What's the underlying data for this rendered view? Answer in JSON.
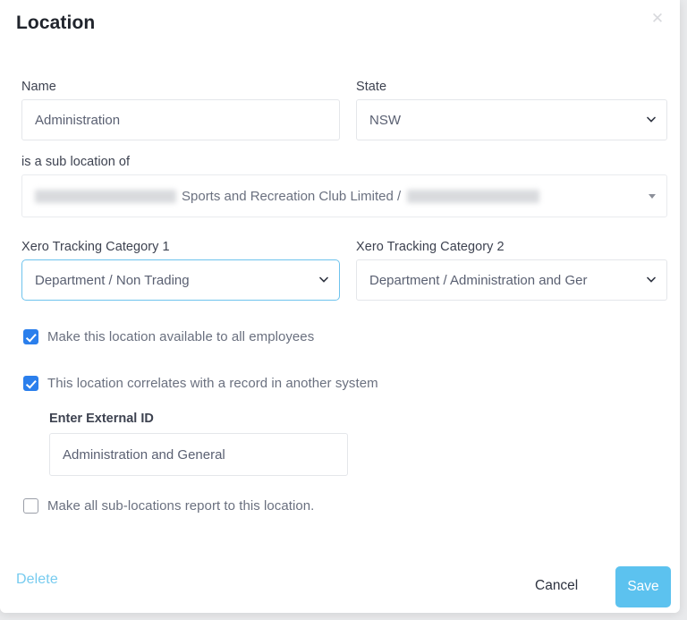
{
  "dialog": {
    "title": "Location",
    "close_icon": "close-icon"
  },
  "fields": {
    "name": {
      "label": "Name",
      "value": "Administration",
      "placeholder": "Name"
    },
    "state": {
      "label": "State",
      "value": "NSW",
      "options": [
        "NSW"
      ]
    },
    "sub_location": {
      "label": "is a sub location of",
      "value_visible": "Sports and Recreation Club Limited /",
      "redacted_before": true,
      "redacted_after": true
    },
    "xero_category_1": {
      "label": "Xero Tracking Category 1",
      "value": "Department / Non Trading",
      "options": [
        "Department / Non Trading"
      ],
      "focused": true
    },
    "xero_category_2": {
      "label": "Xero Tracking Category 2",
      "value": "Department / Administration and Ger",
      "options": [
        "Department / Administration and Ger"
      ],
      "focused": false
    },
    "external_id": {
      "label": "Enter External ID",
      "value": "Administration and General",
      "placeholder": "Enter External ID"
    }
  },
  "checkboxes": {
    "available_to_all": {
      "label": "Make this location available to all employees",
      "checked": true
    },
    "correlates_record": {
      "label": "This location correlates with a record in another system",
      "checked": true
    },
    "sub_locations_report": {
      "label": "Make all sub-locations report to this location.",
      "checked": false
    }
  },
  "footer": {
    "delete_label": "Delete",
    "cancel_label": "Cancel",
    "save_label": "Save"
  },
  "colors": {
    "accent": "#5cc2ef",
    "checkbox": "#2b7fec",
    "focus_border": "#6ec3ed",
    "label_text": "#3d4250",
    "value_text": "#5a6072"
  }
}
